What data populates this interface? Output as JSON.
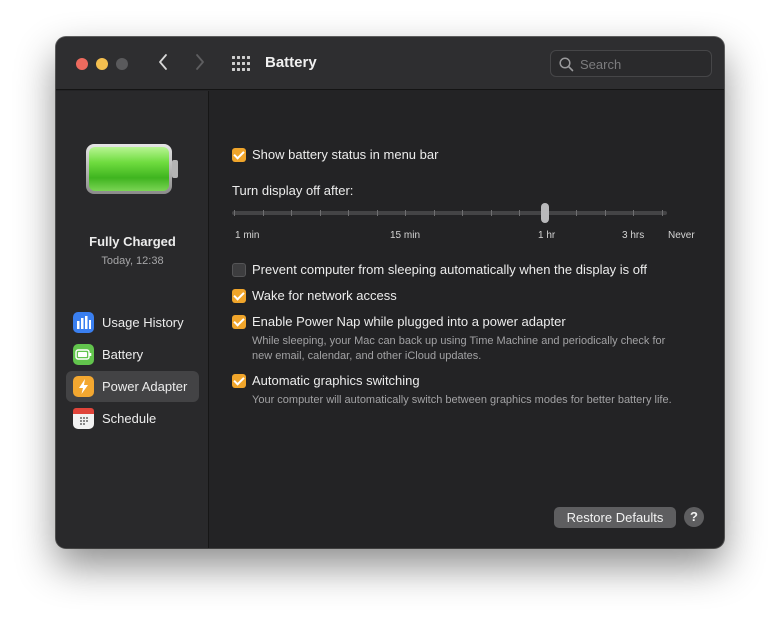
{
  "window": {
    "title": "Battery",
    "search_placeholder": "Search"
  },
  "sidebar": {
    "status_title": "Fully Charged",
    "status_time": "Today, 12:38",
    "items": [
      {
        "label": "Usage History",
        "icon": "bar-chart-icon",
        "color": "#3a7ff0",
        "selected": false
      },
      {
        "label": "Battery",
        "icon": "battery-icon",
        "color": "#62c44d",
        "selected": false
      },
      {
        "label": "Power Adapter",
        "icon": "lightning-icon",
        "color": "#f3a730",
        "selected": true
      },
      {
        "label": "Schedule",
        "icon": "calendar-icon",
        "color": "#f2f2f2",
        "selected": false
      }
    ]
  },
  "content": {
    "show_status": {
      "label": "Show battery status in menu bar",
      "checked": true
    },
    "display_off": {
      "label": "Turn display off after:",
      "tick_labels": [
        "1 min",
        "15 min",
        "1 hr",
        "3 hrs",
        "Never"
      ],
      "value": "1 hr"
    },
    "prevent_sleep": {
      "label": "Prevent computer from sleeping automatically when the display is off",
      "checked": false
    },
    "wake_network": {
      "label": "Wake for network access",
      "checked": true
    },
    "power_nap": {
      "label": "Enable Power Nap while plugged into a power adapter",
      "checked": true,
      "desc_line1": "While sleeping, your Mac can back up using Time Machine and periodically check for",
      "desc_line2": "new email, calendar, and other iCloud updates."
    },
    "graphics_switching": {
      "label": "Automatic graphics switching",
      "checked": true,
      "desc": "Your computer will automatically switch between graphics modes for better battery life."
    }
  },
  "footer": {
    "restore_label": "Restore Defaults",
    "help_label": "?"
  },
  "colors": {
    "accent_checkbox": "#f0a52b",
    "battery_green": "#5fd33c"
  }
}
